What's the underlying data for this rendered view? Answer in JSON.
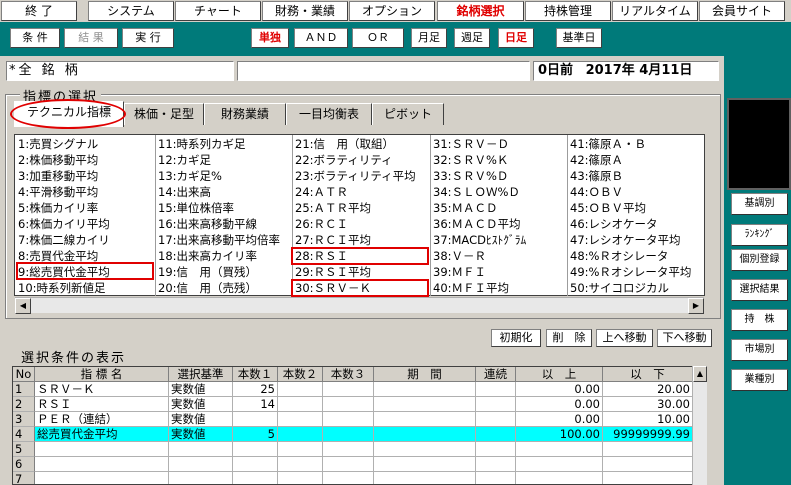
{
  "menu": [
    {
      "label": "終 了",
      "active": false
    },
    {
      "label": "システム",
      "active": false
    },
    {
      "label": "チャート",
      "active": false
    },
    {
      "label": "財務・業績",
      "active": false
    },
    {
      "label": "オプション",
      "active": false
    },
    {
      "label": "銘柄選択",
      "active": true
    },
    {
      "label": "持株管理",
      "active": false
    },
    {
      "label": "リアルタイム",
      "active": false
    },
    {
      "label": "会員サイト",
      "active": false
    }
  ],
  "toolbar": {
    "condition": "条 件",
    "result": "結 果",
    "execute": "実 行",
    "single": "単独",
    "and": "ＡＮＤ",
    "or": "ＯＲ",
    "monthly": "月足",
    "weekly": "週足",
    "daily": "日足",
    "base_date": "基準日"
  },
  "namebar": {
    "stock": "*全 銘 柄",
    "days_ago": "0日前",
    "date": "2017年 4月11日"
  },
  "indicator_section": {
    "title": "指標の選択",
    "tabs": [
      "テクニカル指標",
      "株価・足型",
      "財務業績",
      "一目均衡表",
      "ピボット"
    ],
    "indicators": [
      [
        "1:売買シグナル",
        "2:株価移動平均",
        "3:加重移動平均",
        "4:平滑移動平均",
        "5:株価カイリ率",
        "6:株価カイリ平均",
        "7:株価二線カイリ",
        "8:売買代金平均",
        "9:総売買代金平均",
        "10:時系列新値足"
      ],
      [
        "11:時系列カギ足",
        "12:カギ足",
        "13:カギ足%",
        "14:出来高",
        "15:単位株倍率",
        "16:出来高移動平線",
        "17:出来高移動平均倍率",
        "18:出来高カイリ率",
        "19:信　用（買残）",
        "20:信　用（売残）"
      ],
      [
        "21:信　用（取組）",
        "22:ボラティリティ",
        "23:ボラティリティ平均",
        "24:ＡＴＲ",
        "25:ＡＴＲ平均",
        "26:ＲＣＩ",
        "27:ＲＣＩ平均",
        "28:ＲＳＩ",
        "29:ＲＳＩ平均",
        "30:ＳＲＶ－Ｋ"
      ],
      [
        "31:ＳＲＶ－Ｄ",
        "32:ＳＲＶ%Ｋ",
        "33:ＳＲＶ%Ｄ",
        "34:ＳＬＯＷ%Ｄ",
        "35:ＭＡＣＤ",
        "36:ＭＡＣＤ平均",
        "37:MACDﾋｽﾄｸﾞﾗﾑ",
        "38:Ｖ－Ｒ",
        "39:ＭＦＩ",
        "40:ＭＦＩ平均"
      ],
      [
        "41:篠原Ａ・Ｂ",
        "42:篠原Ａ",
        "43:篠原Ｂ",
        "44:ＯＢＶ",
        "45:ＯＢＶ平均",
        "46:レシオケータ",
        "47:レシオケータ平均",
        "48:%Ｒオシレータ",
        "49:%Ｒオシレータ平均",
        "50:サイコロジカル"
      ]
    ],
    "buttons": {
      "init": "初期化",
      "delete": "削　除",
      "up": "上へ移動",
      "down": "下へ移動"
    }
  },
  "condition_section": {
    "title": "選択条件の表示",
    "headers": [
      "No",
      "指 標 名",
      "選択基準",
      "本数１",
      "本数２",
      "本数３",
      "期　間",
      "連続",
      "以　上",
      "以　下"
    ],
    "rows": [
      {
        "no": "1",
        "name": "ＳＲＶ－Ｋ",
        "basis": "実数値",
        "n1": "25",
        "min": "0.00",
        "max": "20.00"
      },
      {
        "no": "2",
        "name": "ＲＳＩ",
        "basis": "実数値",
        "n1": "14",
        "min": "0.00",
        "max": "30.00"
      },
      {
        "no": "3",
        "name": "ＰＥＲ（連結）",
        "basis": "実数値",
        "n1": "",
        "min": "0.00",
        "max": "10.00"
      },
      {
        "no": "4",
        "name": "総売買代金平均",
        "basis": "実数値",
        "n1": "5",
        "min": "100.00",
        "max": "99999999.99"
      },
      {
        "no": "5",
        "name": "",
        "basis": "",
        "n1": "",
        "min": "",
        "max": ""
      },
      {
        "no": "6",
        "name": "",
        "basis": "",
        "n1": "",
        "min": "",
        "max": ""
      },
      {
        "no": "7",
        "name": "",
        "basis": "",
        "n1": "",
        "min": "",
        "max": ""
      }
    ]
  },
  "side_buttons": [
    "基調別",
    "ﾗﾝｷﾝｸﾞ",
    "個別登録",
    "選択結果",
    "持　株",
    "市場別",
    "業種別"
  ],
  "colors": {
    "teal": "#007a7a",
    "highlight": "#00ffff",
    "red": "#e00000"
  }
}
